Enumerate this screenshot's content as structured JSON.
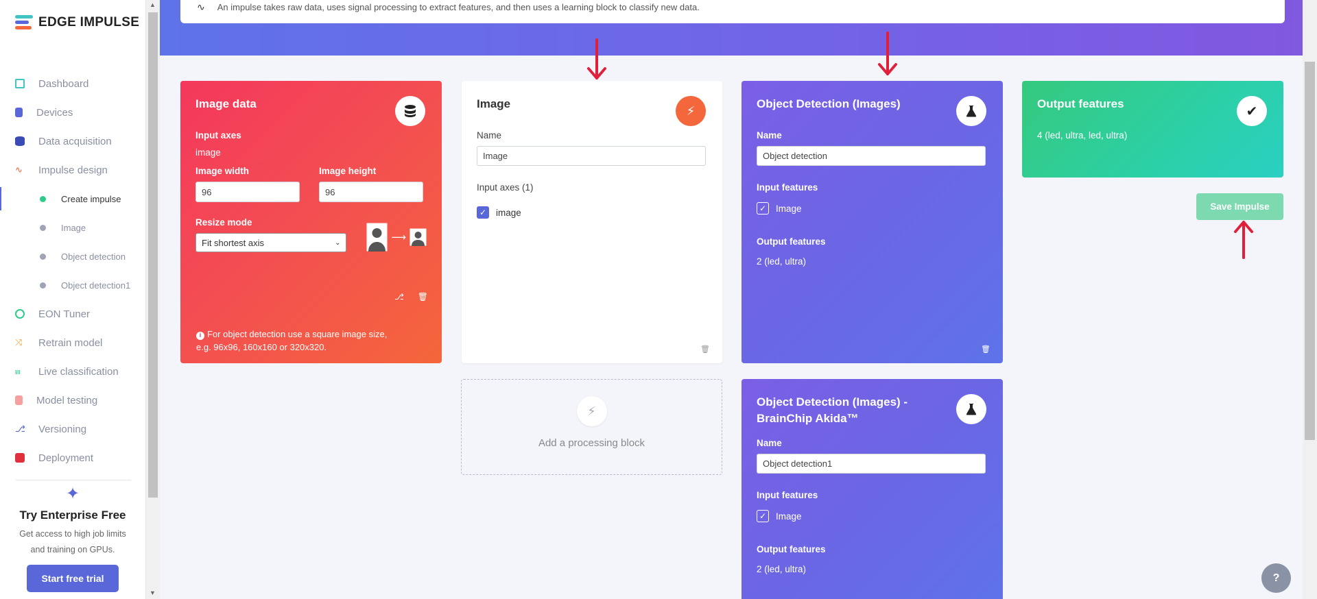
{
  "brand": {
    "name": "EDGE IMPULSE"
  },
  "sidebar": {
    "items": [
      {
        "label": "Dashboard",
        "icon": "monitor-icon",
        "color": "#41c4c4"
      },
      {
        "label": "Devices",
        "icon": "chip-icon",
        "color": "#5a67d8"
      },
      {
        "label": "Data acquisition",
        "icon": "database-icon",
        "color": "#3a4bb5"
      },
      {
        "label": "Impulse design",
        "icon": "pulse-icon",
        "color": "#f4663b"
      }
    ],
    "subitems": [
      {
        "label": "Create impulse"
      },
      {
        "label": "Image"
      },
      {
        "label": "Object detection"
      },
      {
        "label": "Object detection1"
      }
    ],
    "items2": [
      {
        "label": "EON Tuner",
        "icon": "compass-icon",
        "color": "#2ecc8a"
      },
      {
        "label": "Retrain model",
        "icon": "shuffle-icon",
        "color": "#f0a030"
      },
      {
        "label": "Live classification",
        "icon": "network-icon",
        "color": "#2ecc8a"
      },
      {
        "label": "Model testing",
        "icon": "clipboard-icon",
        "color": "#f08080"
      },
      {
        "label": "Versioning",
        "icon": "branch-icon",
        "color": "#5a67d8"
      },
      {
        "label": "Deployment",
        "icon": "box-icon",
        "color": "#e03040"
      }
    ],
    "promo": {
      "title": "Try Enterprise Free",
      "text_line1": "Get access to high job limits",
      "text_line2": "and training on GPUs.",
      "button": "Start free trial"
    }
  },
  "info": {
    "text": "An impulse takes raw data, uses signal processing to extract features, and then uses a learning block to classify new data."
  },
  "input_block": {
    "title": "Image data",
    "input_axes_label": "Input axes",
    "input_axes_value": "image",
    "width_label": "Image width",
    "width_value": "96",
    "height_label": "Image height",
    "height_value": "96",
    "resize_label": "Resize mode",
    "resize_value": "Fit shortest axis",
    "note_line1": "For object detection use a square image size,",
    "note_line2": "e.g. 96x96, 160x160 or 320x320."
  },
  "processing_block": {
    "title": "Image",
    "name_label": "Name",
    "name_value": "Image",
    "axes_label": "Input axes (1)",
    "axis_item": "image"
  },
  "add_block": {
    "label": "Add a processing block"
  },
  "learning_block_1": {
    "title": "Object Detection (Images)",
    "name_label": "Name",
    "name_value": "Object detection",
    "input_label": "Input features",
    "input_item": "Image",
    "output_label": "Output features",
    "output_value": "2 (led, ultra)"
  },
  "learning_block_2": {
    "title_line1": "Object Detection (Images) -",
    "title_line2": "BrainChip Akida™",
    "name_label": "Name",
    "name_value": "Object detection1",
    "input_label": "Input features",
    "input_item": "Image",
    "output_label": "Output features",
    "output_value": "2 (led, ultra)"
  },
  "output_block": {
    "title": "Output features",
    "value": "4 (led, ultra, led, ultra)"
  },
  "save_button": "Save Impulse",
  "help": "?"
}
